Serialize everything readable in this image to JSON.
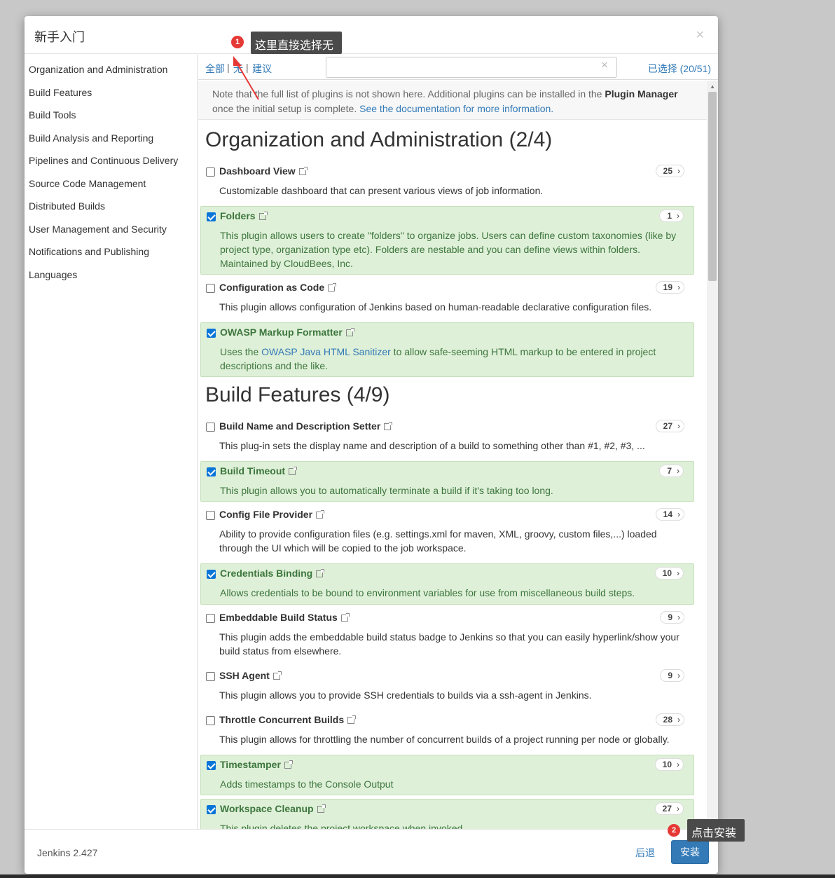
{
  "dialog": {
    "title": "新手入门",
    "close_label": "×"
  },
  "sidebar": {
    "items": [
      {
        "label": "Organization and Administration"
      },
      {
        "label": "Build Features"
      },
      {
        "label": "Build Tools"
      },
      {
        "label": "Build Analysis and Reporting"
      },
      {
        "label": "Pipelines and Continuous Delivery"
      },
      {
        "label": "Source Code Management"
      },
      {
        "label": "Distributed Builds"
      },
      {
        "label": "User Management and Security"
      },
      {
        "label": "Notifications and Publishing"
      },
      {
        "label": "Languages"
      }
    ]
  },
  "filter": {
    "all": "全部",
    "none": "无",
    "suggested": "建议",
    "separator": "|",
    "search_value": "",
    "clear_label": "×",
    "selected": "已选择 (20/51)"
  },
  "note": {
    "text1": "Note that the full list of plugins is not shown here. Additional plugins can be installed in the ",
    "bold": "Plugin Manager",
    "text2": " once the initial setup is complete. ",
    "link": "See the documentation for more information."
  },
  "categories": [
    {
      "title": "Organization and Administration (2/4)",
      "plugins": [
        {
          "name": "Dashboard View",
          "deps": "25",
          "checked": false,
          "desc": "Customizable dashboard that can present various views of job information."
        },
        {
          "name": "Folders",
          "deps": "1",
          "checked": true,
          "desc": "This plugin allows users to create \"folders\" to organize jobs. Users can define custom taxonomies (like by project type, organization type etc). Folders are nestable and you can define views within folders. Maintained by CloudBees, Inc."
        },
        {
          "name": "Configuration as Code",
          "deps": "19",
          "checked": false,
          "desc": "This plugin allows configuration of Jenkins based on human-readable declarative configuration files."
        },
        {
          "name": "OWASP Markup Formatter",
          "deps": "",
          "checked": true,
          "desc_pre": "Uses the ",
          "desc_link": "OWASP Java HTML Sanitizer",
          "desc_post": " to allow safe-seeming HTML markup to be entered in project descriptions and the like."
        }
      ]
    },
    {
      "title": "Build Features (4/9)",
      "plugins": [
        {
          "name": "Build Name and Description Setter",
          "deps": "27",
          "checked": false,
          "desc": "This plug-in sets the display name and description of a build to something other than #1, #2, #3, ..."
        },
        {
          "name": "Build Timeout",
          "deps": "7",
          "checked": true,
          "desc": "This plugin allows you to automatically terminate a build if it's taking too long."
        },
        {
          "name": "Config File Provider",
          "deps": "14",
          "checked": false,
          "desc": "Ability to provide configuration files (e.g. settings.xml for maven, XML, groovy, custom files,...) loaded through the UI which will be copied to the job workspace."
        },
        {
          "name": "Credentials Binding",
          "deps": "10",
          "checked": true,
          "desc": "Allows credentials to be bound to environment variables for use from miscellaneous build steps."
        },
        {
          "name": "Embeddable Build Status",
          "deps": "9",
          "checked": false,
          "desc": "This plugin adds the embeddable build status badge to Jenkins so that you can easily hyperlink/show your build status from elsewhere."
        },
        {
          "name": "SSH Agent",
          "deps": "9",
          "checked": false,
          "desc": "This plugin allows you to provide SSH credentials to builds via a ssh-agent in Jenkins."
        },
        {
          "name": "Throttle Concurrent Builds",
          "deps": "28",
          "checked": false,
          "desc": "This plugin allows for throttling the number of concurrent builds of a project running per node or globally."
        },
        {
          "name": "Timestamper",
          "deps": "10",
          "checked": true,
          "desc": "Adds timestamps to the Console Output"
        },
        {
          "name": "Workspace Cleanup",
          "deps": "27",
          "checked": true,
          "desc": "This plugin deletes the project workspace when invoked."
        }
      ]
    }
  ],
  "footer": {
    "version": "Jenkins 2.427",
    "back": "后退",
    "install": "安装"
  },
  "annotations": {
    "callout1": {
      "badge": "1",
      "text": "这里直接选择无"
    },
    "callout2": {
      "badge": "2",
      "text": "点击安装"
    }
  },
  "colors": {
    "accent": "#337ab7",
    "checked_bg": "#dff0d8",
    "checked_text": "#3c763d",
    "callout_bg": "#4a4a4a",
    "badge_red": "#e53935"
  }
}
